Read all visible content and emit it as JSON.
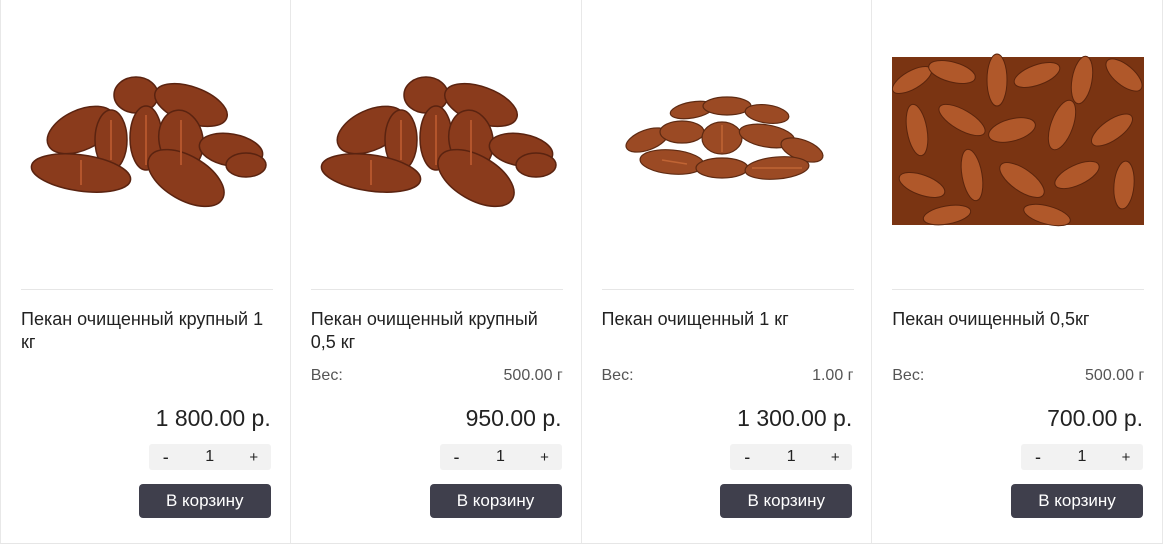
{
  "products": [
    {
      "title": "Пекан очищенный крупный 1 кг",
      "weight_label": "",
      "weight_value": "",
      "price": "1 800.00 р.",
      "qty": "1",
      "minus": "-",
      "plus": "+",
      "button": "В корзину"
    },
    {
      "title": "Пекан очищенный крупный 0,5 кг",
      "weight_label": "Вес:",
      "weight_value": "500.00 г",
      "price": "950.00 р.",
      "qty": "1",
      "minus": "-",
      "plus": "+",
      "button": "В корзину"
    },
    {
      "title": "Пекан очищенный 1 кг",
      "weight_label": "Вес:",
      "weight_value": "1.00 г",
      "price": "1 300.00 р.",
      "qty": "1",
      "minus": "-",
      "plus": "+",
      "button": "В корзину"
    },
    {
      "title": "Пекан очищенный 0,5кг",
      "weight_label": "Вес:",
      "weight_value": "500.00 г",
      "price": "700.00 р.",
      "qty": "1",
      "minus": "-",
      "plus": "+",
      "button": "В корзину"
    }
  ],
  "colors": {
    "button_bg": "#3f3f4c",
    "qty_bg": "#f2f2f2",
    "nut": "#8a3b1c",
    "nut_light": "#b4552c"
  },
  "icons": {
    "product_image": "pecan-nuts-image"
  }
}
